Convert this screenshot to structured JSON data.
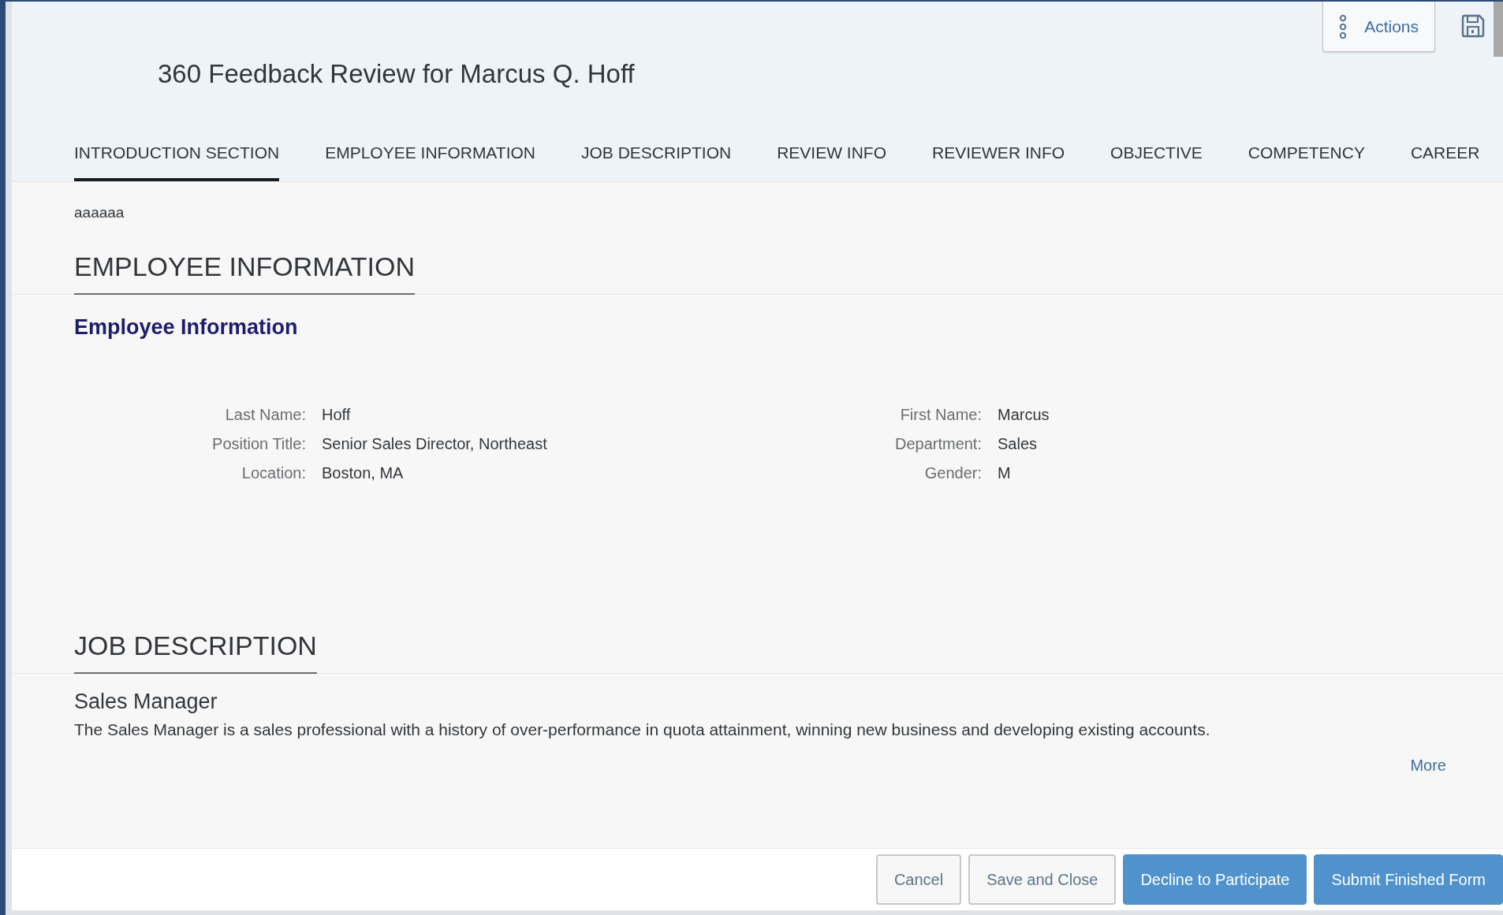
{
  "header": {
    "title": "360 Feedback Review for Marcus Q. Hoff",
    "actions_button": "Actions"
  },
  "tabs": [
    {
      "label": "INTRODUCTION SECTION",
      "selected": true
    },
    {
      "label": "EMPLOYEE INFORMATION",
      "selected": false
    },
    {
      "label": "JOB DESCRIPTION",
      "selected": false
    },
    {
      "label": "REVIEW INFO",
      "selected": false
    },
    {
      "label": "REVIEWER INFO",
      "selected": false
    },
    {
      "label": "OBJECTIVE",
      "selected": false
    },
    {
      "label": "COMPETENCY",
      "selected": false
    },
    {
      "label": "CAREER",
      "selected": false
    }
  ],
  "intro_text": "aaaaaa",
  "sections": [
    {
      "kind": "fields",
      "heading": "EMPLOYEE INFORMATION",
      "subheading": "Employee Information",
      "columns": [
        [
          {
            "label": "Last Name:",
            "value": "Hoff"
          },
          {
            "label": "Position Title:",
            "value": "Senior Sales Director, Northeast"
          },
          {
            "label": "Location:",
            "value": "Boston, MA"
          }
        ],
        [
          {
            "label": "First Name:",
            "value": "Marcus"
          },
          {
            "label": "Department:",
            "value": "Sales"
          },
          {
            "label": "Gender:",
            "value": "M"
          }
        ]
      ]
    },
    {
      "kind": "job",
      "heading": "JOB DESCRIPTION",
      "job_title": "Sales Manager",
      "description": "The Sales Manager is a sales professional with a history of over-performance in quota attainment, winning new business and developing existing accounts.",
      "more_link": "More"
    }
  ],
  "footer_buttons": [
    {
      "label": "Cancel",
      "kind": "secondary"
    },
    {
      "label": "Save and Close",
      "kind": "secondary"
    },
    {
      "label": "Decline to Participate",
      "kind": "primary"
    },
    {
      "label": "Submit Finished Form",
      "kind": "primary"
    }
  ]
}
